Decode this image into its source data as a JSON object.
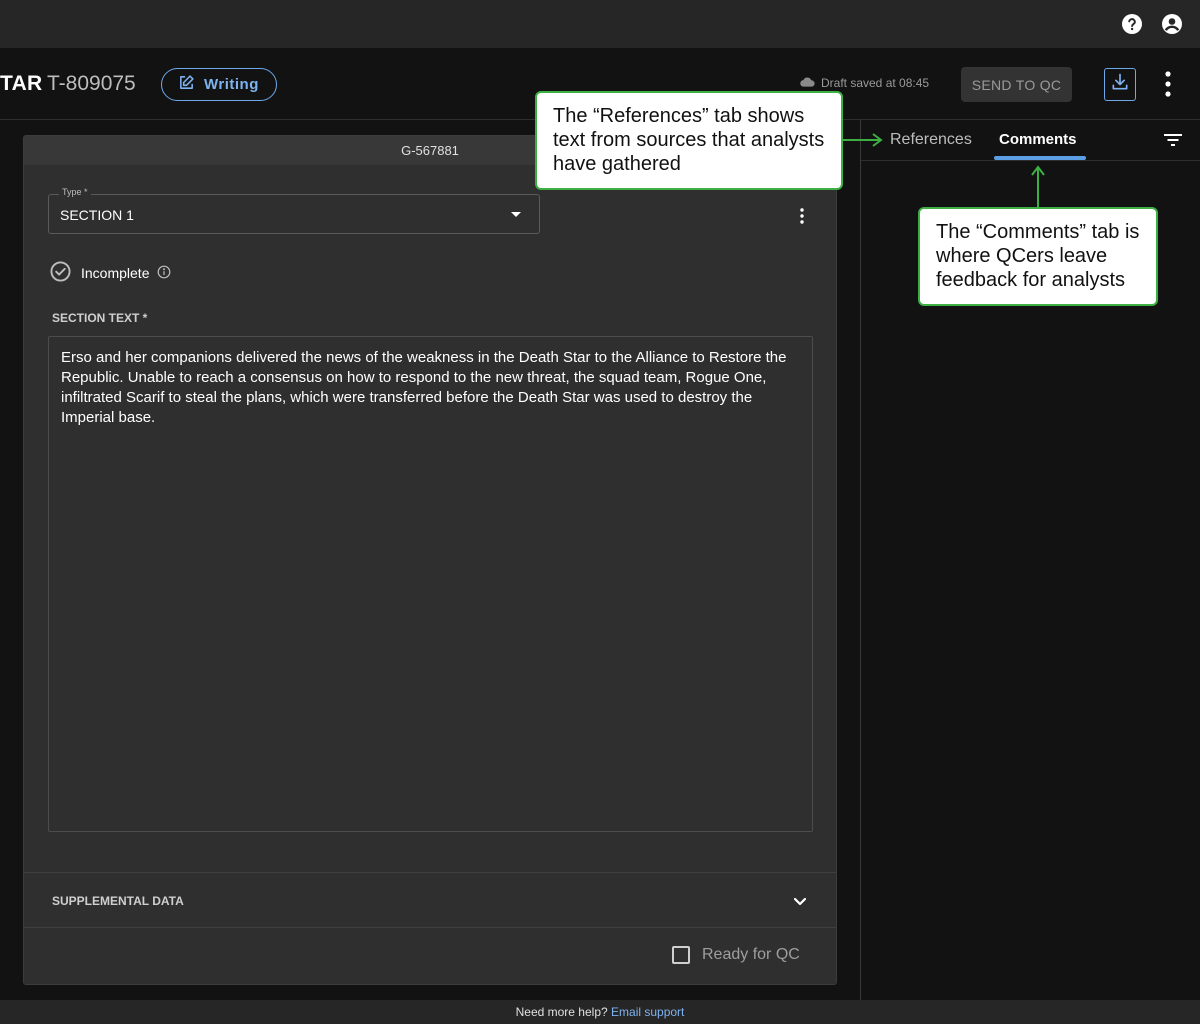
{
  "topbar": {
    "help_icon": "help-circle-icon",
    "account_icon": "account-circle-icon"
  },
  "header": {
    "title_fragment": "TAR",
    "doc_id": "T-809075",
    "mode_button": "Writing",
    "draft_status": "Draft saved at 08:45",
    "send_button": "SEND TO QC",
    "download_icon": "download-icon",
    "more_icon": "more-vert-icon"
  },
  "card": {
    "header_id": "G-567881",
    "type_label": "Type *",
    "type_value": "SECTION 1",
    "status_text": "Incomplete",
    "section_label": "SECTION TEXT *",
    "section_text": "Erso and her companions delivered the news of the weakness in the Death Star to the Alliance to Restore the Republic. Unable to reach a consensus on how to respond to the new threat, the squad team, Rogue One, infiltrated Scarif to steal the plans, which were transferred before the Death Star was used to destroy the Imperial base.",
    "supplemental_label": "SUPPLEMENTAL DATA",
    "ready_label": "Ready for QC",
    "ready_checked": false
  },
  "panel": {
    "tab_references": "References",
    "tab_comments": "Comments",
    "active_tab": "Comments"
  },
  "callouts": {
    "references": "The “References” tab shows text from sources that analysts have gathered",
    "comments": "The “Comments” tab is where QCers leave feedback for analysts"
  },
  "footer": {
    "help_text": "Need more help?",
    "link_text": "Email support"
  },
  "colors": {
    "accent_blue": "#6ea8ea",
    "callout_green": "#3cb043",
    "background": "#121212",
    "card": "#2f2f2f"
  }
}
